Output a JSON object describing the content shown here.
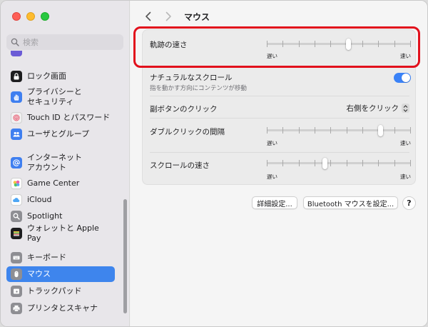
{
  "window": {
    "title": "マウス"
  },
  "search": {
    "placeholder": "検索",
    "icon": "search-icon"
  },
  "sidebar": {
    "items": [
      {
        "label": "ロック画面",
        "icon": "lock-icon",
        "color": "#1d1d1f"
      },
      {
        "label": "プライバシーと\nセキュリティ",
        "icon": "hand-icon",
        "color": "#3f7ff0"
      },
      {
        "label": "Touch ID とパスワード",
        "icon": "fingerprint-icon",
        "color": "#f1f1f1"
      },
      {
        "label": "ユーザとグループ",
        "icon": "users-icon",
        "color": "#3f7ff0"
      },
      {
        "label": "インターネット\nアカウント",
        "icon": "at-icon",
        "color": "#3f7ff0"
      },
      {
        "label": "Game Center",
        "icon": "game-center-icon",
        "color": "#ffffff"
      },
      {
        "label": "iCloud",
        "icon": "cloud-icon",
        "color": "#ffffff"
      },
      {
        "label": "Spotlight",
        "icon": "spotlight-icon",
        "color": "#8e8e93"
      },
      {
        "label": "ウォレットと Apple Pay",
        "icon": "wallet-icon",
        "color": "#1d1d1f"
      },
      {
        "label": "キーボード",
        "icon": "keyboard-icon",
        "color": "#8e8e93"
      },
      {
        "label": "マウス",
        "icon": "mouse-icon",
        "color": "#8e8e93"
      },
      {
        "label": "トラックパッド",
        "icon": "trackpad-icon",
        "color": "#8e8e93"
      },
      {
        "label": "プリンタとスキャナ",
        "icon": "printer-icon",
        "color": "#8e8e93"
      }
    ],
    "active": "マウス"
  },
  "settings": {
    "tracking": {
      "label": "軌跡の速さ",
      "slow": "遅い",
      "fast": "速い",
      "value": 0.57
    },
    "natural_scroll": {
      "label": "ナチュラルなスクロール",
      "sub": "指を動かす方向にコンテンツが移動",
      "on": true
    },
    "secondary_click": {
      "label": "副ボタンのクリック",
      "value": "右側をクリック"
    },
    "double_click": {
      "label": "ダブルクリックの間隔",
      "slow": "遅い",
      "fast": "速い",
      "value": 0.8
    },
    "scroll_speed": {
      "label": "スクロールの速さ",
      "slow": "遅い",
      "fast": "速い",
      "value": 0.4
    }
  },
  "buttons": {
    "advanced": "詳細設定...",
    "bluetooth": "Bluetooth マウスを設定...",
    "help": "?"
  },
  "colors": {
    "accent": "#3e85ed",
    "highlight": "#e2101c"
  }
}
